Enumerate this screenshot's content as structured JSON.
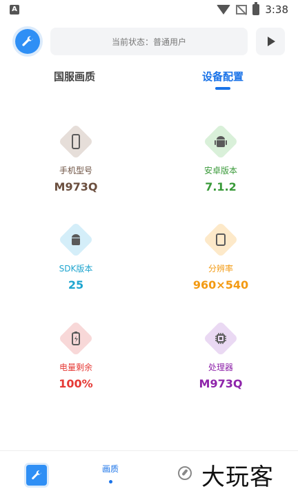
{
  "status_bar": {
    "time": "3:38"
  },
  "topbar": {
    "status_text": "当前状态：普通用户"
  },
  "tabs": [
    {
      "label": "国服画质"
    },
    {
      "label": "设备配置"
    }
  ],
  "cards": [
    {
      "label": "手机型号",
      "value": "M973Q",
      "icon": "phone-icon",
      "bg": "#e6ded9",
      "color": "#6b4f3f"
    },
    {
      "label": "安卓版本",
      "value": "7.1.2",
      "icon": "android-icon",
      "bg": "#d9f0d9",
      "color": "#3a9a3a"
    },
    {
      "label": "SDK版本",
      "value": "25",
      "icon": "android-icon",
      "bg": "#d4eef9",
      "color": "#1fa5cf"
    },
    {
      "label": "分辨率",
      "value": "960×540",
      "icon": "tablet-icon",
      "bg": "#fde9c9",
      "color": "#f39a12"
    },
    {
      "label": "电量剩余",
      "value": "100%",
      "icon": "battery-icon",
      "bg": "#f8d8d8",
      "color": "#e53935"
    },
    {
      "label": "处理器",
      "value": "M973Q",
      "icon": "chip-icon",
      "bg": "#ead9f3",
      "color": "#8e24aa"
    }
  ],
  "bottom_nav": {
    "active_label": "画质",
    "watermark": "大玩客"
  },
  "colors": {
    "accent": "#1a73e8",
    "wrench_bg": "#2f8ff5"
  }
}
